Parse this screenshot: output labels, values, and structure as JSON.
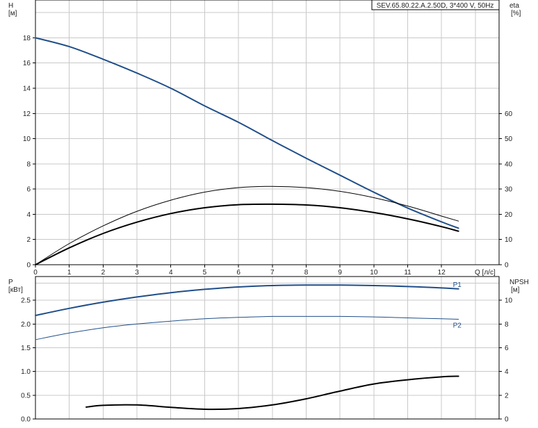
{
  "colors": {
    "head": "#1f4e89",
    "eff_pump": "#000000",
    "eff_total": "#000000",
    "p1": "#1f4e89",
    "p2": "#1f4e89",
    "npsh": "#000000",
    "grid": "#c8c8c8"
  },
  "chart_data": [
    {
      "type": "line",
      "title": "SEV.65.80.22.A.2.50D, 3*400 V, 50Hz",
      "xlabel": "Q [л/с]",
      "xlim": [
        0,
        13.7
      ],
      "xticks": [
        "0",
        "1",
        "2",
        "3",
        "4",
        "5",
        "6",
        "7",
        "8",
        "9",
        "10",
        "11",
        "12"
      ],
      "ylabel_left": [
        "H",
        "[м]"
      ],
      "ylim_left": [
        0,
        21
      ],
      "yticks_left": [
        "0",
        "2",
        "4",
        "6",
        "8",
        "10",
        "12",
        "14",
        "16",
        "18"
      ],
      "ylabel_right": [
        "eta",
        "[%]"
      ],
      "ylim_right": [
        0,
        105
      ],
      "yticks_right": [
        "0",
        "10",
        "20",
        "30",
        "40",
        "50",
        "60"
      ],
      "grid": true,
      "series": [
        {
          "axis": "left",
          "color_key": "head",
          "width": 2,
          "x": [
            0,
            1,
            2,
            3,
            4,
            5,
            6,
            7,
            8,
            9,
            10,
            11,
            12,
            12.5
          ],
          "y": [
            18,
            17.3,
            16.3,
            15.2,
            14,
            12.6,
            11.3,
            9.85,
            8.45,
            7.1,
            5.75,
            4.5,
            3.4,
            2.9
          ]
        },
        {
          "axis": "right",
          "color_key": "eff_pump",
          "width": 1,
          "x": [
            0,
            1,
            2,
            3,
            4,
            5,
            6,
            7,
            8,
            9,
            10,
            11,
            12,
            12.5
          ],
          "y": [
            0,
            8.4,
            15.4,
            21.2,
            25.6,
            28.8,
            30.6,
            31.1,
            30.6,
            29.1,
            26.6,
            23.3,
            19.3,
            17.3
          ]
        },
        {
          "axis": "right",
          "color_key": "eff_total",
          "width": 2,
          "x": [
            0,
            1,
            2,
            3,
            4,
            5,
            6,
            7,
            8,
            9,
            10,
            11,
            12,
            12.5
          ],
          "y": [
            0,
            6.7,
            12.4,
            16.9,
            20.3,
            22.6,
            23.8,
            24,
            23.7,
            22.6,
            20.7,
            18.2,
            15.1,
            13.3
          ]
        }
      ]
    },
    {
      "type": "line",
      "xlim": [
        0,
        13.7
      ],
      "ylabel_left": [
        "P",
        "[кВт]"
      ],
      "ylim_left": [
        0,
        3.0
      ],
      "yticks_left": [
        "0.0",
        "0.5",
        "1.0",
        "1.5",
        "2.0",
        "2.5"
      ],
      "ylabel_right": [
        "NPSH",
        "[м]"
      ],
      "ylim_right": [
        0,
        12
      ],
      "yticks_right": [
        "0",
        "2",
        "4",
        "6",
        "8",
        "10"
      ],
      "grid": true,
      "series": [
        {
          "name": "P1",
          "axis": "left",
          "color_key": "p1",
          "width": 2,
          "x": [
            0,
            1,
            2,
            3,
            4,
            5,
            6,
            7,
            8,
            9,
            10,
            11,
            12,
            12.5
          ],
          "y": [
            2.18,
            2.33,
            2.46,
            2.57,
            2.66,
            2.73,
            2.78,
            2.81,
            2.82,
            2.82,
            2.81,
            2.79,
            2.76,
            2.74
          ]
        },
        {
          "name": "P2",
          "axis": "left",
          "color_key": "p2",
          "width": 1,
          "x": [
            0,
            1,
            2,
            3,
            4,
            5,
            6,
            7,
            8,
            9,
            10,
            11,
            12,
            12.5
          ],
          "y": [
            1.67,
            1.81,
            1.92,
            2.0,
            2.06,
            2.11,
            2.14,
            2.16,
            2.16,
            2.16,
            2.15,
            2.13,
            2.11,
            2.1
          ]
        },
        {
          "axis": "right",
          "color_key": "npsh",
          "width": 2,
          "x": [
            1.5,
            2,
            3,
            4,
            5,
            6,
            7,
            8,
            9,
            10,
            11,
            12,
            12.5
          ],
          "y": [
            1.0,
            1.15,
            1.18,
            0.98,
            0.82,
            0.88,
            1.18,
            1.7,
            2.35,
            2.95,
            3.3,
            3.55,
            3.6
          ]
        }
      ]
    }
  ]
}
